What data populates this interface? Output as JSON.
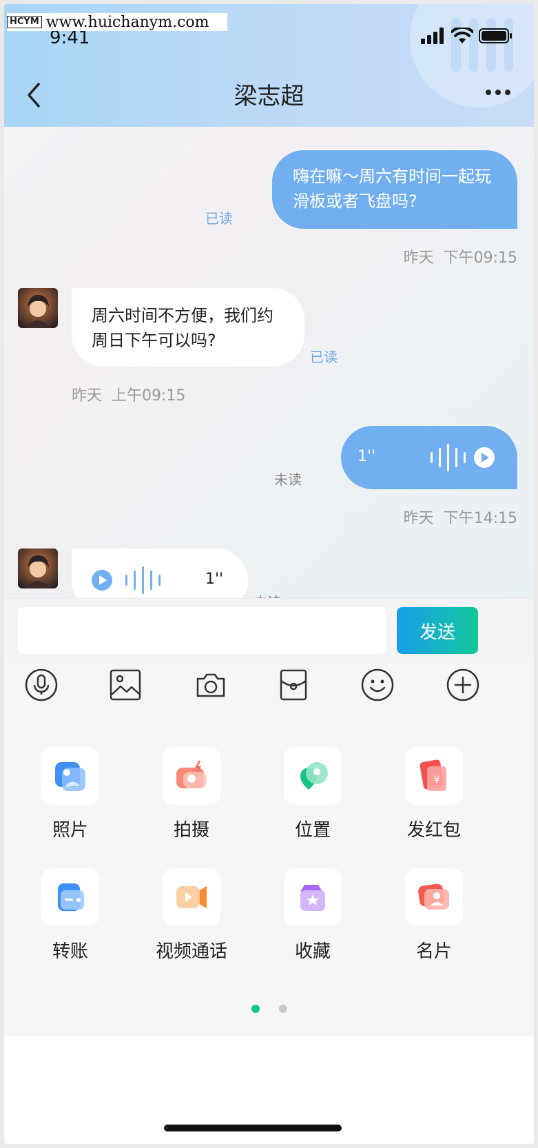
{
  "watermark": {
    "logo": "HCYM",
    "url": "www.huichanym.com"
  },
  "status_bar": {
    "time": "9:41"
  },
  "nav": {
    "title": "梁志超"
  },
  "messages": [
    {
      "side": "right",
      "type": "text",
      "text": "嗨在嘛～周六有时间一起玩滑板或者飞盘吗?",
      "status": "已读",
      "time": "昨天  下午09:15"
    },
    {
      "side": "left",
      "type": "text",
      "text": "周六时间不方便，我们约周日下午可以吗?",
      "status": "已读",
      "time": "昨天  上午09:15"
    },
    {
      "side": "right",
      "type": "voice",
      "duration": "1''",
      "status": "未读",
      "time": "昨天  下午14:15"
    },
    {
      "side": "left",
      "type": "voice",
      "duration": "1''",
      "status": "未读"
    }
  ],
  "input": {
    "value": "",
    "placeholder": "",
    "send_label": "发送"
  },
  "toolbar": [
    "microphone-icon",
    "image-icon",
    "camera-icon",
    "red-packet-icon",
    "emoji-icon",
    "add-icon"
  ],
  "features": [
    {
      "label": "照片",
      "icon": "photo-icon"
    },
    {
      "label": "拍摄",
      "icon": "shoot-icon"
    },
    {
      "label": "位置",
      "icon": "location-icon"
    },
    {
      "label": "发红包",
      "icon": "red-packet-icon"
    },
    {
      "label": "转账",
      "icon": "transfer-icon"
    },
    {
      "label": "视频通话",
      "icon": "video-call-icon"
    },
    {
      "label": "收藏",
      "icon": "favorites-icon"
    },
    {
      "label": "名片",
      "icon": "contact-card-icon"
    }
  ],
  "pagination": {
    "current": 1,
    "total": 2
  },
  "colors": {
    "accent_blue": "#71aff0",
    "read_blue": "#6ba9ea",
    "send_green": "#12c79b",
    "active_dot": "#13c585"
  }
}
